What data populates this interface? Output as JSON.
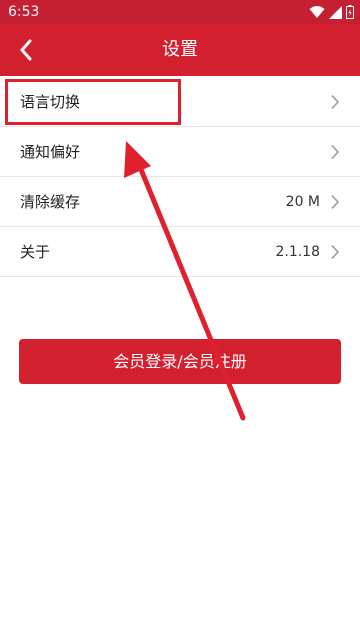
{
  "status_bar": {
    "time": "6:53",
    "icons": [
      "wifi-icon",
      "signal-icon",
      "battery-icon"
    ]
  },
  "header": {
    "title": "设置",
    "back_icon": "chevron-left-icon"
  },
  "settings": {
    "items": [
      {
        "label": "语言切换",
        "value": ""
      },
      {
        "label": "通知偏好",
        "value": ""
      },
      {
        "label": "清除缓存",
        "value": "20 M"
      },
      {
        "label": "关于",
        "value": "2.1.18"
      }
    ]
  },
  "actions": {
    "login_register_label": "会员登录/会员注册"
  },
  "colors": {
    "brand_red": "#d2202f",
    "status_red": "#c41f33",
    "annotation_red": "#e0202e"
  }
}
